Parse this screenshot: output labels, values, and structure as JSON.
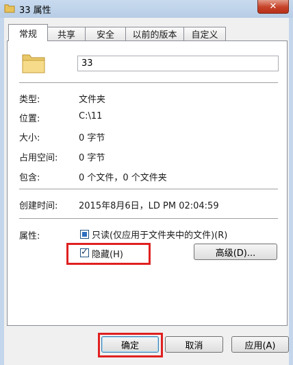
{
  "window": {
    "title": "33 属性",
    "close_label": "✕"
  },
  "tabs": [
    {
      "label": "常规",
      "active": true
    },
    {
      "label": "共享"
    },
    {
      "label": "安全"
    },
    {
      "label": "以前的版本"
    },
    {
      "label": "自定义"
    }
  ],
  "general": {
    "name_value": "33",
    "fields": {
      "type_label": "类型:",
      "type_value": "文件夹",
      "location_label": "位置:",
      "location_value": "C:\\11",
      "size_label": "大小:",
      "size_value": "0 字节",
      "disk_label": "占用空间:",
      "disk_value": "0 字节",
      "contains_label": "包含:",
      "contains_value": "0 个文件，0 个文件夹",
      "created_label": "创建时间:",
      "created_value": "2015年8月6日，LD PM 02:04:59"
    },
    "attributes": {
      "label": "属性:",
      "readonly_label": "只读(仅应用于文件夹中的文件)(R)",
      "readonly_state": "indeterminate",
      "hidden_label": "隐藏(H)",
      "hidden_checked": true,
      "advanced_label": "高级(D)..."
    }
  },
  "buttons": {
    "ok": "确定",
    "cancel": "取消",
    "apply": "应用(A)"
  },
  "colors": {
    "highlight": "#e02020",
    "titlebar": "#b7cde6",
    "close": "#c7442a"
  }
}
